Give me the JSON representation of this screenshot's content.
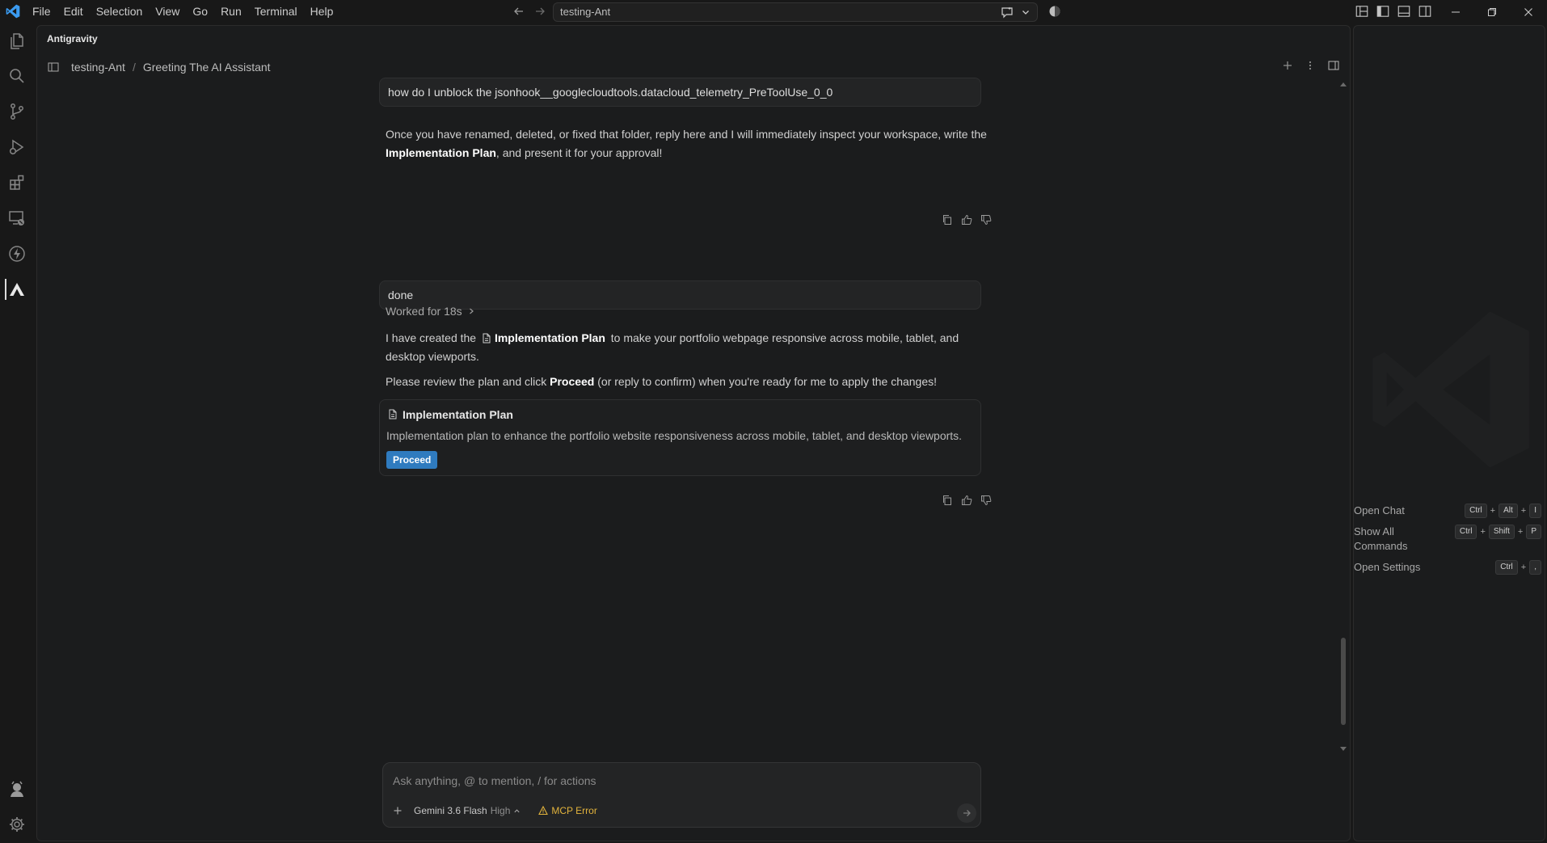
{
  "menu": {
    "items": [
      "File",
      "Edit",
      "Selection",
      "View",
      "Go",
      "Run",
      "Terminal",
      "Help"
    ]
  },
  "command_center": {
    "label": "testing-Ant"
  },
  "panel": {
    "title": "Antigravity",
    "breadcrumb": [
      "testing-Ant",
      "/",
      "Greeting The AI Assistant"
    ]
  },
  "chat": {
    "user_message_1": "how do I unblock the jsonhook__googlecloudtools.datacloud_telemetry_PreToolUse_0_0",
    "ai_message_1": {
      "part1": "Once you have renamed, deleted, or fixed that folder, reply here and I will immediately inspect your workspace, write the ",
      "bold": "Implementation Plan",
      "part2": ", and present it for your approval!"
    },
    "user_message_2": "done",
    "worked_for": "Worked for 18s",
    "ai_message_2": {
      "p1_start": "I have created the",
      "p1_link": "Implementation Plan",
      "p1_end": "to make your portfolio webpage responsive across mobile, tablet, and desktop viewports.",
      "p2_start": "Please review the plan and click ",
      "p2_bold": "Proceed",
      "p2_end": " (or reply to confirm) when you're ready for me to apply the changes!"
    },
    "plan_card": {
      "title": "Implementation Plan",
      "description": "Implementation plan to enhance the portfolio website responsiveness across mobile, tablet, and desktop viewports.",
      "button": "Proceed"
    }
  },
  "input": {
    "placeholder": "Ask anything, @ to mention, / for actions",
    "model": "Gemini 3.6 Flash",
    "model_level": "High",
    "mcp_error": "MCP Error"
  },
  "shortcuts": [
    {
      "label": "Open Chat",
      "keys": [
        "Ctrl",
        "+",
        "Alt",
        "+",
        "I"
      ]
    },
    {
      "label": "Show All Commands",
      "keys": [
        "Ctrl",
        "+",
        "Shift",
        "+",
        "P"
      ]
    },
    {
      "label": "Open Settings",
      "keys": [
        "Ctrl",
        "+",
        ","
      ]
    }
  ],
  "colors": {
    "background": "#181818",
    "panel": "#1b1c1d",
    "accent": "#2f7bbf",
    "warning": "#e2b33c",
    "logo": "#3b9bf0"
  },
  "icons": {
    "activity_bar": [
      "files-icon",
      "search-icon",
      "source-control-icon",
      "run-debug-icon",
      "extensions-icon",
      "remote-explorer-icon",
      "lightning-icon",
      "antigravity-icon",
      "accounts-icon",
      "settings-gear-icon"
    ]
  }
}
